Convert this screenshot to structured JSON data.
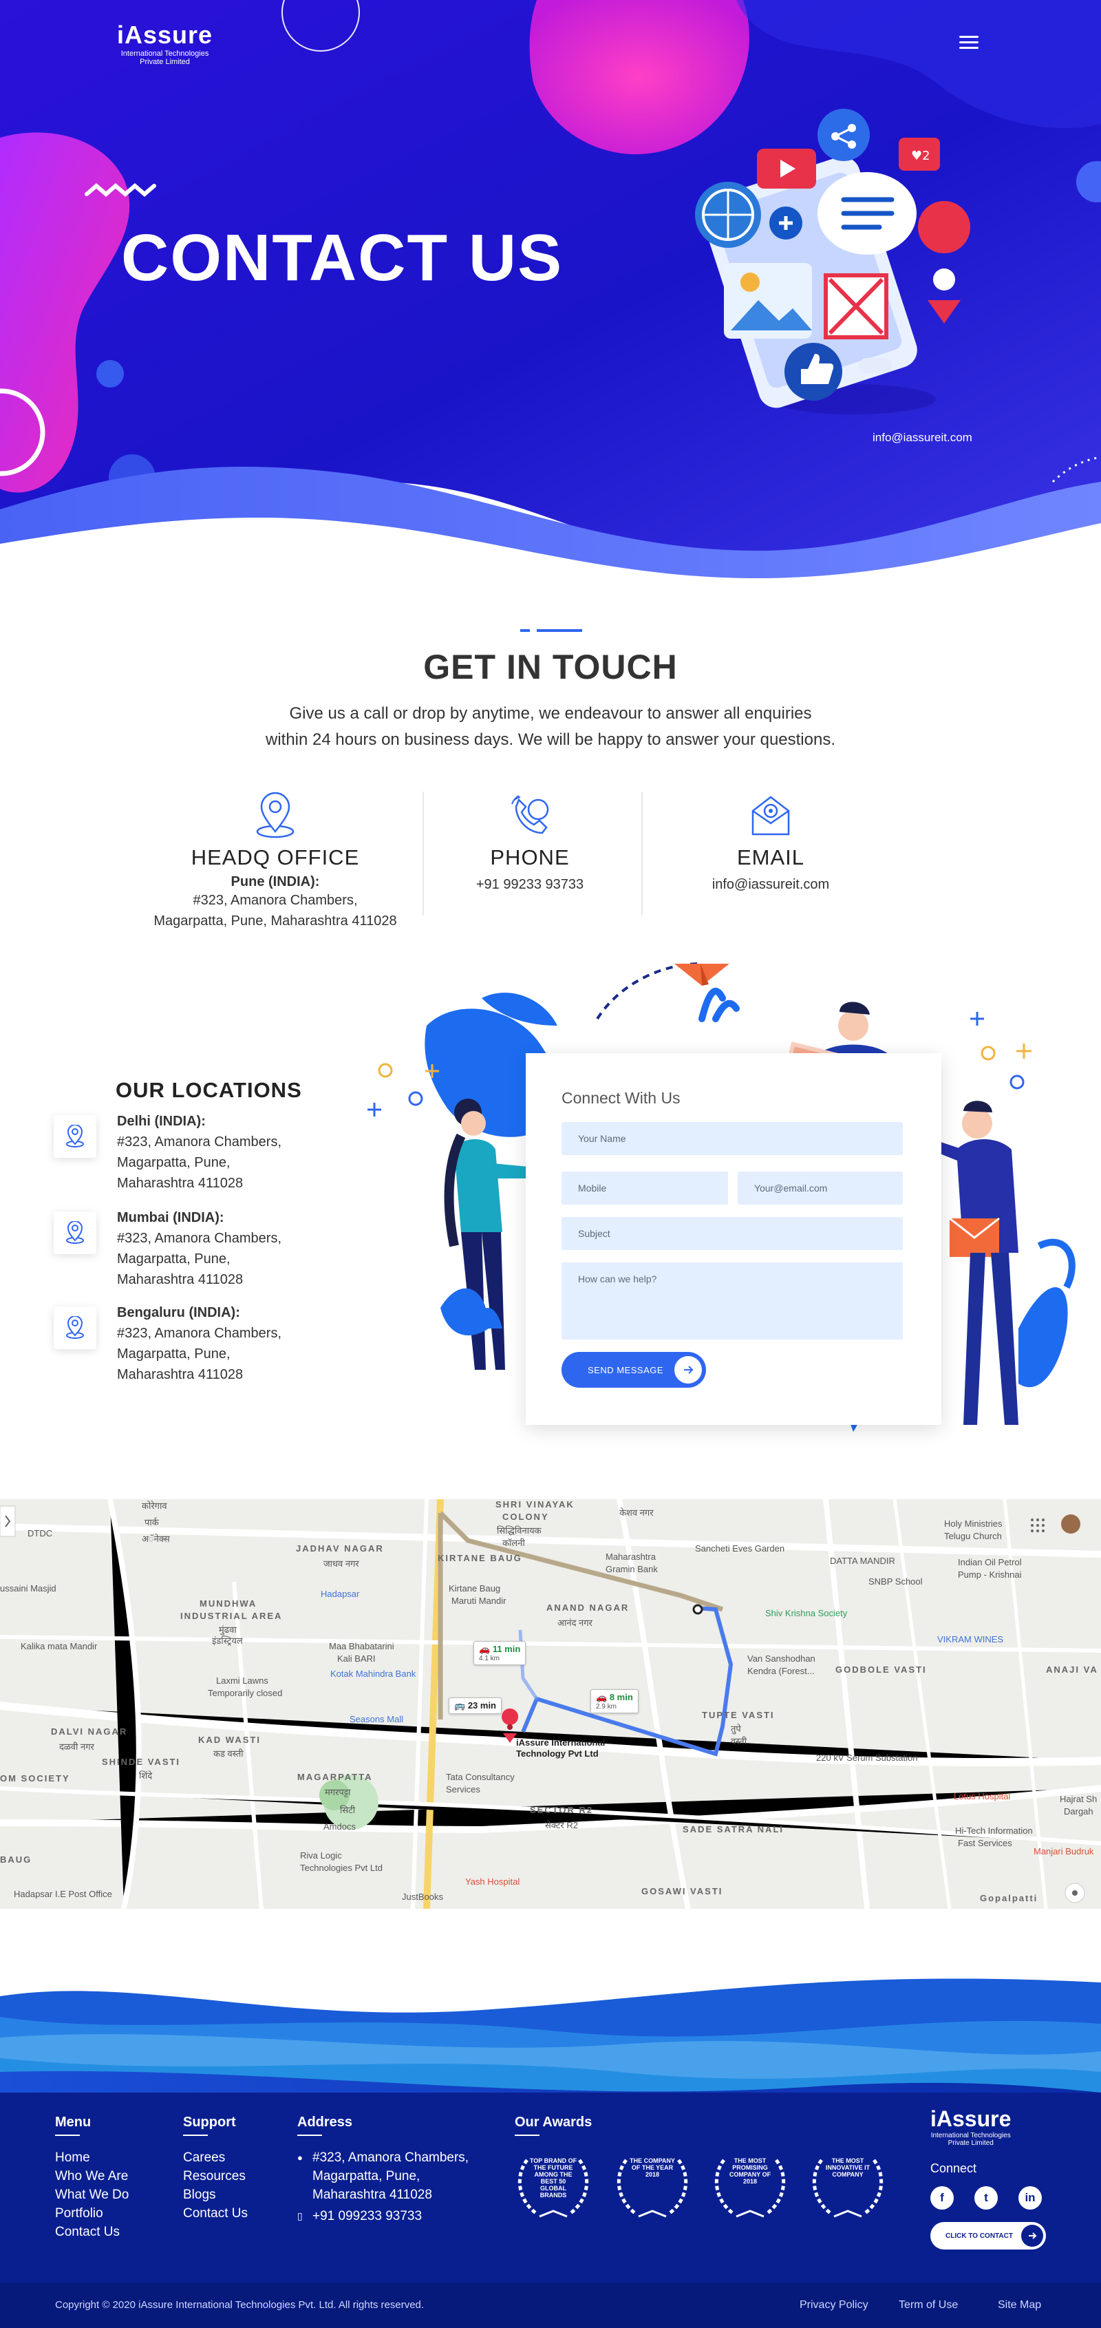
{
  "brand": {
    "logo_text": "iAssure",
    "logo_sub_line1": "International Technologies",
    "logo_sub_line2": "Private Limited"
  },
  "hero": {
    "title": "CONTACT US",
    "email": "info@iassureit.com"
  },
  "touch": {
    "title": "GET IN TOUCH",
    "subtitle_line1": "Give us a call or drop by anytime, we endeavour to answer all enquiries",
    "subtitle_line2": "within 24 hours on business days. We will be happy to answer your questions."
  },
  "contact_info": {
    "office": {
      "heading": "HEADQ OFFICE",
      "label": "Pune (INDIA):",
      "line1": "#323, Amanora Chambers,",
      "line2": "Magarpatta, Pune, Maharashtra 411028"
    },
    "phone": {
      "heading": "PHONE",
      "value": "+91 99233 93733"
    },
    "email": {
      "heading": "EMAIL",
      "value": "info@iassureit.com"
    }
  },
  "locations": {
    "title": "OUR LOCATIONS",
    "items": [
      {
        "city": "Delhi (INDIA):",
        "line1": "#323, Amanora Chambers,",
        "line2": "Magarpatta, Pune,",
        "line3": "Maharashtra 411028"
      },
      {
        "city": "Mumbai (INDIA):",
        "line1": "#323, Amanora Chambers,",
        "line2": "Magarpatta, Pune,",
        "line3": "Maharashtra 411028"
      },
      {
        "city": "Bengaluru (INDIA):",
        "line1": "#323, Amanora Chambers,",
        "line2": "Magarpatta, Pune,",
        "line3": "Maharashtra 411028"
      }
    ]
  },
  "form": {
    "title": "Connect With Us",
    "name_placeholder": "Your Name",
    "mobile_placeholder": "Mobile",
    "email_placeholder": "Your@email.com",
    "subject_placeholder": "Subject",
    "message_placeholder": "How can we help?",
    "send_label": "SEND MESSAGE"
  },
  "map": {
    "labels": {
      "koregaon": "कोरेगाव",
      "park": "पार्क",
      "annex": "अॅनेक्स",
      "dtdc": "DTDC",
      "vinayak": "SHRI VINAYAK",
      "colony": "COLONY",
      "vinayak_mr": "सिद्धिविनायक",
      "colony_mr": "कॉलनी",
      "kesav": "केशव नगर",
      "holy": "Holy Ministries",
      "telugu": "Telugu Church",
      "jadhav": "JADHAV NAGAR",
      "jadhav_mr": "जाधव नगर",
      "kirtane": "KIRTANE BAUG",
      "maharashtra_bank": "Maharashtra",
      "gramin": "Gramin Bank",
      "sancheti": "Sancheti Eves Garden",
      "datta": "DATTA MANDIR",
      "snbp": "SNBP School",
      "indian_oil": "Indian Oil Petrol",
      "pump": "Pump - Krishnai",
      "masjid": "ussaini Masjid",
      "hadapsar": "Hadapsar",
      "kirtane_baug": "Kirtane Baug",
      "maruti": "Maruti Mandir",
      "anand": "ANAND NAGAR",
      "anand_mr": "आनंद नगर",
      "shiv": "Shiv Krishna Society",
      "mundhwa": "MUNDHWA",
      "ind_area": "INDUSTRIAL AREA",
      "mundhwa_mr": "मुंढवा",
      "ind_mr": "इंडस्ट्रियल",
      "kalika": "Kalika mata Mandir",
      "maa": "Maa Bhabatarini",
      "kalibari": "Kali BARI",
      "kotak": "Kotak Mahindra Bank",
      "vikram": "VIKRAM WINES",
      "vansh": "Van Sanshodhan",
      "kendra": "Kendra (Forest...",
      "godbole": "GODBOLE VASTI",
      "anaji": "ANAJI VA",
      "laxmi": "Laxmi Lawns",
      "temp_closed": "Temporarily closed",
      "tupe": "TUPTE VASTI",
      "tupe_mr": "तुपे",
      "vasti_mr": "वस्ती",
      "kv_station": "220 kV Serum Substation",
      "dalvi": "DALVI NAGAR",
      "dalvi_mr": "दळवी नगर",
      "kad": "KAD WASTI",
      "kad_mr": "कड वस्ती",
      "seasons": "Seasons Mall",
      "shinde": "SHINDE VASTI",
      "shinde_mr": "शिंदे",
      "om": "OM SOCIETY",
      "magar": "MAGARPATTA",
      "magar_mr": "मगरपट्टा",
      "city_mr": "सिटी",
      "amdocs": "Amdocs",
      "tata": "Tata Consultancy",
      "services": "Services",
      "sector": "SECTOR R2",
      "sector_mr": "सेक्टर R2",
      "sade": "SADE SATRA NALI",
      "lotus": "Lotus Hospital",
      "hitech": "Hi-Tech Information",
      "fast": "Fast Services",
      "hajrat": "Hajrat Sh",
      "dargah": "Dargah",
      "manjari": "Manjari Budruk",
      "riva": "Riva Logic",
      "riva2": "Technologies Pvt Ltd",
      "yash": "Yash Hospital",
      "justbooks": "JustBooks",
      "gosawi": "GOSAWI VASTI",
      "baug": "BAUG",
      "hadapsar_ie": "Hadapsar I.E Post Office",
      "gopalpatti": "Gopalpatti",
      "pin_name1": "iAssure International",
      "pin_name2": "Technology Pvt Ltd"
    },
    "routes": [
      {
        "time": "11 min",
        "dist": "4.1 km"
      },
      {
        "time": "23 min",
        "dist": ""
      },
      {
        "time": "8 min",
        "dist": "2.9 km"
      }
    ]
  },
  "footer": {
    "menu": {
      "title": "Menu",
      "items": [
        "Home",
        "Who We Are",
        "What We Do",
        "Portfolio",
        "Contact Us"
      ]
    },
    "support": {
      "title": "Support",
      "items": [
        "Carees",
        "Resources",
        "Blogs",
        "Contact Us"
      ]
    },
    "address": {
      "title": "Address",
      "line1": "#323, Amanora Chambers,",
      "line2": "Magarpatta, Pune,",
      "line3": "Maharashtra 411028",
      "phone": "+91 099233 93733"
    },
    "awards": {
      "title": "Our Awards",
      "items": [
        "TOP BRAND OF THE FUTURE AMONG THE BEST 50 GLOBAL BRANDS",
        "THE COMPANY OF THE YEAR 2018",
        "THE MOST PROMISING COMPANY OF 2018",
        "THE MOST INNOVATIVE IT COMPANY"
      ]
    },
    "connect": "Connect",
    "contact_button": "CLICK TO CONTACT",
    "copyright": "Copyright © 2020 iAssure International Technologies Pvt. Ltd. All rights reserved.",
    "links": [
      "Privacy Policy",
      "Term of Use",
      "Site Map"
    ]
  },
  "colors": {
    "hero_blue": "#1a10d6",
    "magenta": "#e52bd2",
    "accent_blue": "#2f66f0",
    "footer_navy": "#0a1f8f",
    "field_bg": "#e3efff"
  }
}
